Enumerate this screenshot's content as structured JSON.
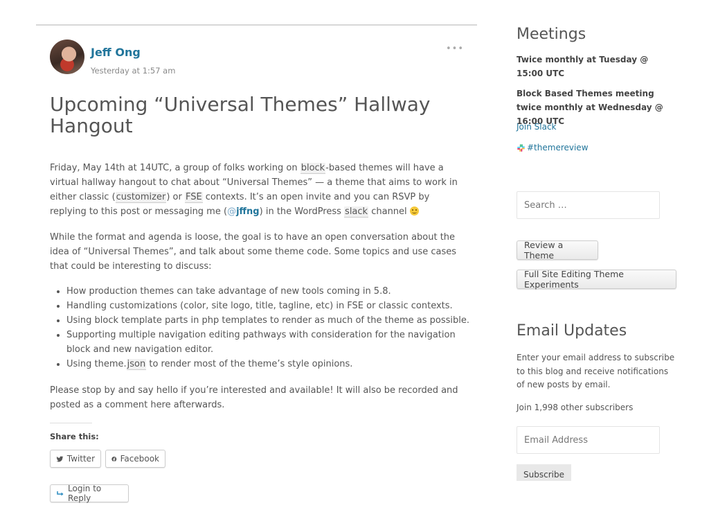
{
  "post": {
    "author": "Jeff Ong",
    "time": "Yesterday at 1:57 am",
    "more_menu": "•••",
    "title": "Upcoming “Universal Themes” Hallway Hangout",
    "para1": {
      "t1": "Friday, May 14th at 14UTC, a group of folks working on ",
      "block": "block",
      "t2": "-based themes will have a virtual hallway hangout to chat about “Universal Themes” — a theme that aims to work in either classic (",
      "customizer": "customizer",
      "t3": ") or ",
      "fse": "FSE",
      "t4": " contexts. It’s an open invite and you can RSVP by replying to this post or messaging me (",
      "mention_at": "@",
      "mention_user": "jffng",
      "t5": ") in the WordPress ",
      "slack": "slack",
      "t6": " channel "
    },
    "para2": "While the format and agenda is loose, the goal is to have an open conversation about the idea of “Universal Themes”, and talk about some theme code. Some topics and use cases that could be interesting to discuss:",
    "topics": [
      "How production themes can take advantage of new tools coming in 5.8.",
      "Handling customizations (color, site logo, title, tagline, etc) in FSE or classic contexts.",
      "Using block template parts in php templates to render as much of the theme as possible.",
      "Supporting multiple navigation editing pathways with consideration for the navigation block and new navigation editor."
    ],
    "topic5": {
      "a": "Using theme.",
      "json": "json",
      "b": " to render most of the theme’s style opinions."
    },
    "para3": "Please stop by and say hello if you’re interested and available! It will also be recorded and posted as a comment here afterwards.",
    "share_heading": "Share this:",
    "twitter_label": "Twitter",
    "facebook_label": "Facebook",
    "login_reply_label": "Login to Reply"
  },
  "sidebar": {
    "meetings_heading": "Meetings",
    "meeting1": "Twice monthly at Tuesday @ 15:00 UTC",
    "meeting2": "Block Based Themes meeting twice monthly at Wednesday @ 16:00 UTC",
    "join_slack": "Join Slack",
    "themereview": "#themereview",
    "search_placeholder": "Search …",
    "review_theme_label": "Review a Theme",
    "fse_label": "Full Site Editing Theme Experiments",
    "email_heading": "Email Updates",
    "email_desc": "Enter your email address to subscribe to this blog and receive notifications of new posts by email.",
    "subscribers": "Join 1,998 other subscribers",
    "email_placeholder": "Email Address",
    "subscribe_label": "Subscribe"
  },
  "colors": {
    "link": "#21759b",
    "text": "#555555"
  },
  "icons": [
    "twitter-icon",
    "facebook-icon",
    "reply-icon",
    "slack-icon",
    "smiley-icon"
  ]
}
